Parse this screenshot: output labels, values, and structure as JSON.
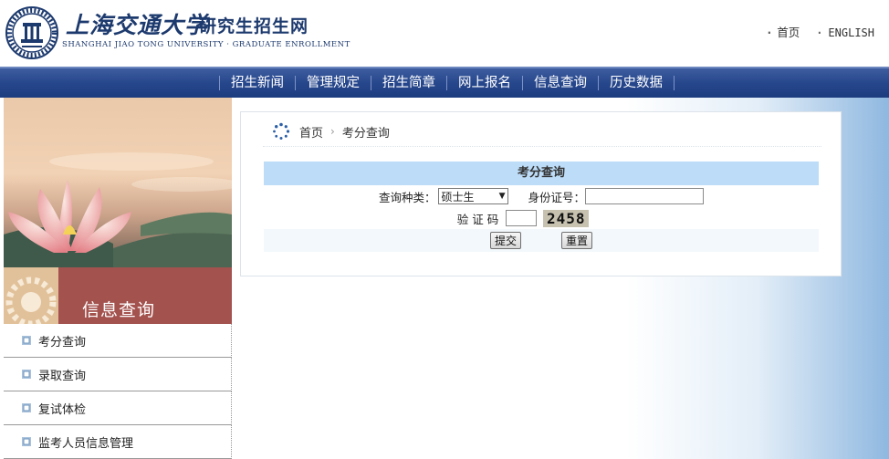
{
  "header": {
    "logo_cn": "上海交通大学",
    "site_name": "研究生招生网",
    "logo_en": "SHANGHAI JIAO TONG UNIVERSITY · GRADUATE ENROLLMENT",
    "links": [
      {
        "label": "首页"
      },
      {
        "label": "ENGLISH"
      }
    ]
  },
  "nav": {
    "items": [
      {
        "label": "招生新闻"
      },
      {
        "label": "管理规定"
      },
      {
        "label": "招生简章"
      },
      {
        "label": "网上报名"
      },
      {
        "label": "信息查询"
      },
      {
        "label": "历史数据"
      }
    ]
  },
  "sidebar": {
    "title": "信息查询",
    "items": [
      {
        "label": "考分查询"
      },
      {
        "label": "录取查询"
      },
      {
        "label": "复试体检"
      },
      {
        "label": "监考人员信息管理"
      }
    ]
  },
  "breadcrumb": {
    "home": "首页",
    "current": "考分查询"
  },
  "form": {
    "title": "考分查询",
    "type_label": "查询种类：",
    "type_value": "硕士生",
    "id_label": "身份证号：",
    "id_value": "",
    "captcha_label": "验 证 码",
    "captcha_value": "",
    "captcha_code": "2458",
    "submit_label": "提交",
    "reset_label": "重置"
  },
  "colors": {
    "nav_bg": "#27478c",
    "banner_bg": "#a3524e",
    "form_header_bg": "#bcdcf7",
    "brand_text": "#1d3a6e"
  }
}
